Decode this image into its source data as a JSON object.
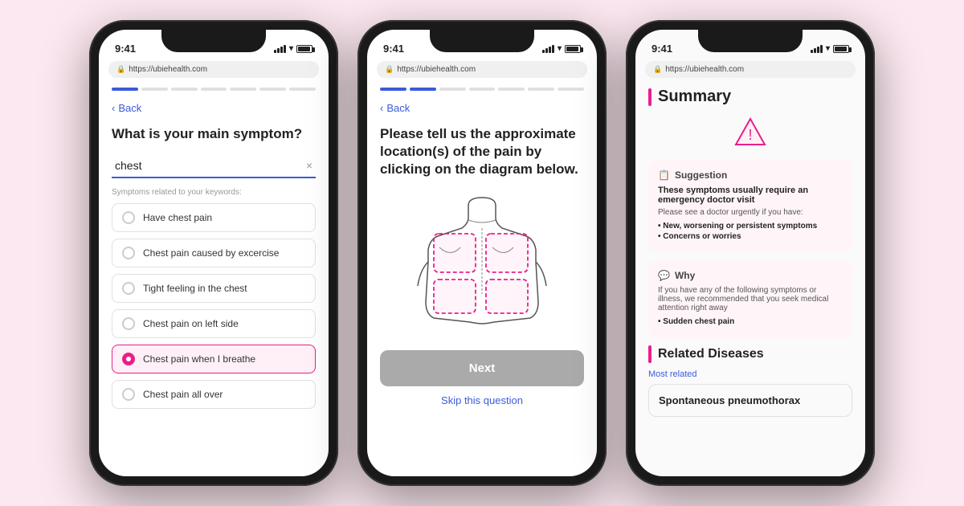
{
  "background": "#fce8f0",
  "phones": [
    {
      "id": "phone1",
      "time": "9:41",
      "url": "https://ubiehealth.com",
      "screen": "symptom-search",
      "progress": [
        true,
        false,
        false,
        false,
        false,
        false,
        false
      ],
      "back_label": "Back",
      "title": "What is your main symptom?",
      "search_value": "chest",
      "search_clear": "×",
      "symptoms_label": "Symptoms related to your keywords:",
      "options": [
        {
          "label": "Have chest pain",
          "selected": false
        },
        {
          "label": "Chest pain caused by excercise",
          "selected": false
        },
        {
          "label": "Tight feeling in the chest",
          "selected": false
        },
        {
          "label": "Chest pain on left side",
          "selected": false
        },
        {
          "label": "Chest pain when I breathe",
          "selected": true
        },
        {
          "label": "Chest pain all over",
          "selected": false
        }
      ]
    },
    {
      "id": "phone2",
      "time": "9:41",
      "url": "https://ubiehealth.com",
      "screen": "body-diagram",
      "progress": [
        true,
        true,
        false,
        false,
        false,
        false,
        false
      ],
      "back_label": "Back",
      "title": "Please tell us the approximate location(s) of the pain by clicking on the diagram below.",
      "next_label": "Next",
      "skip_label": "Skip this question"
    },
    {
      "id": "phone3",
      "time": "9:41",
      "url": "https://ubiehealth.com",
      "screen": "summary",
      "title": "Summary",
      "warning_icon": "⚠",
      "suggestion": {
        "icon": "📋",
        "title": "Suggestion",
        "subtitle": "These symptoms usually require an emergency doctor visit",
        "desc": "Please see a doctor urgently if you have:",
        "bullets": [
          "New, worsening or persistent symptoms",
          "Concerns or worries"
        ]
      },
      "why": {
        "icon": "💬",
        "title": "Why",
        "desc": "If you have any of the following symptoms or illness, we recommended that you seek medical attention right away",
        "bullets": [
          "Sudden chest pain"
        ]
      },
      "related_diseases": {
        "title": "Related Diseases",
        "most_related_label": "Most related",
        "diseases": [
          "Spontaneous pneumothorax"
        ]
      }
    }
  ]
}
